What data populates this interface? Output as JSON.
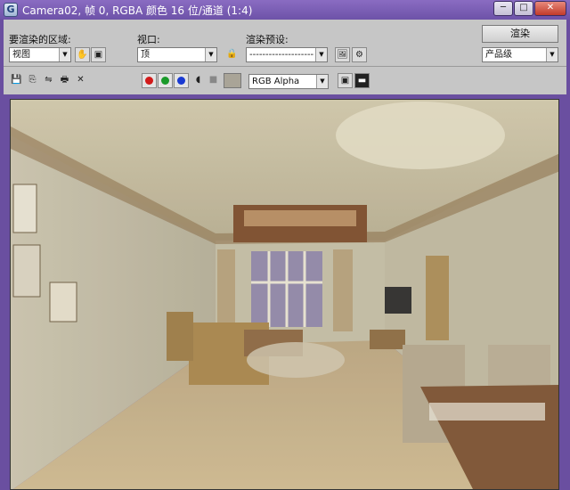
{
  "window": {
    "title": "Camera02, 帧 0, RGBA 颜色 16 位/通道 (1:4)",
    "app_icon_glyph": "G",
    "minimize_glyph": "─",
    "maximize_glyph": "□",
    "close_glyph": "✕"
  },
  "toolbar": {
    "area_label": "要渲染的区域:",
    "area_value": "视图",
    "viewport_label": "视口:",
    "viewport_value": "顶",
    "preset_label": "渲染预设:",
    "preset_value": "--------------------",
    "render_button": "渲染",
    "quality_value": "产品级",
    "channel_value": "RGB Alpha",
    "icons": {
      "pan": "✋",
      "region": "▣",
      "lock": "🔒",
      "env": "🖼",
      "setup": "⚙",
      "save": "💾",
      "copy": "⎘",
      "clone": "⇋",
      "print": "🖶",
      "clear": "✕",
      "mono": "◖",
      "alpha": "■",
      "display1": "▣",
      "display2": "▬"
    },
    "channel_colors": {
      "red": "#d21a1a",
      "green": "#1a9a2a",
      "blue": "#1a3ad2"
    }
  }
}
